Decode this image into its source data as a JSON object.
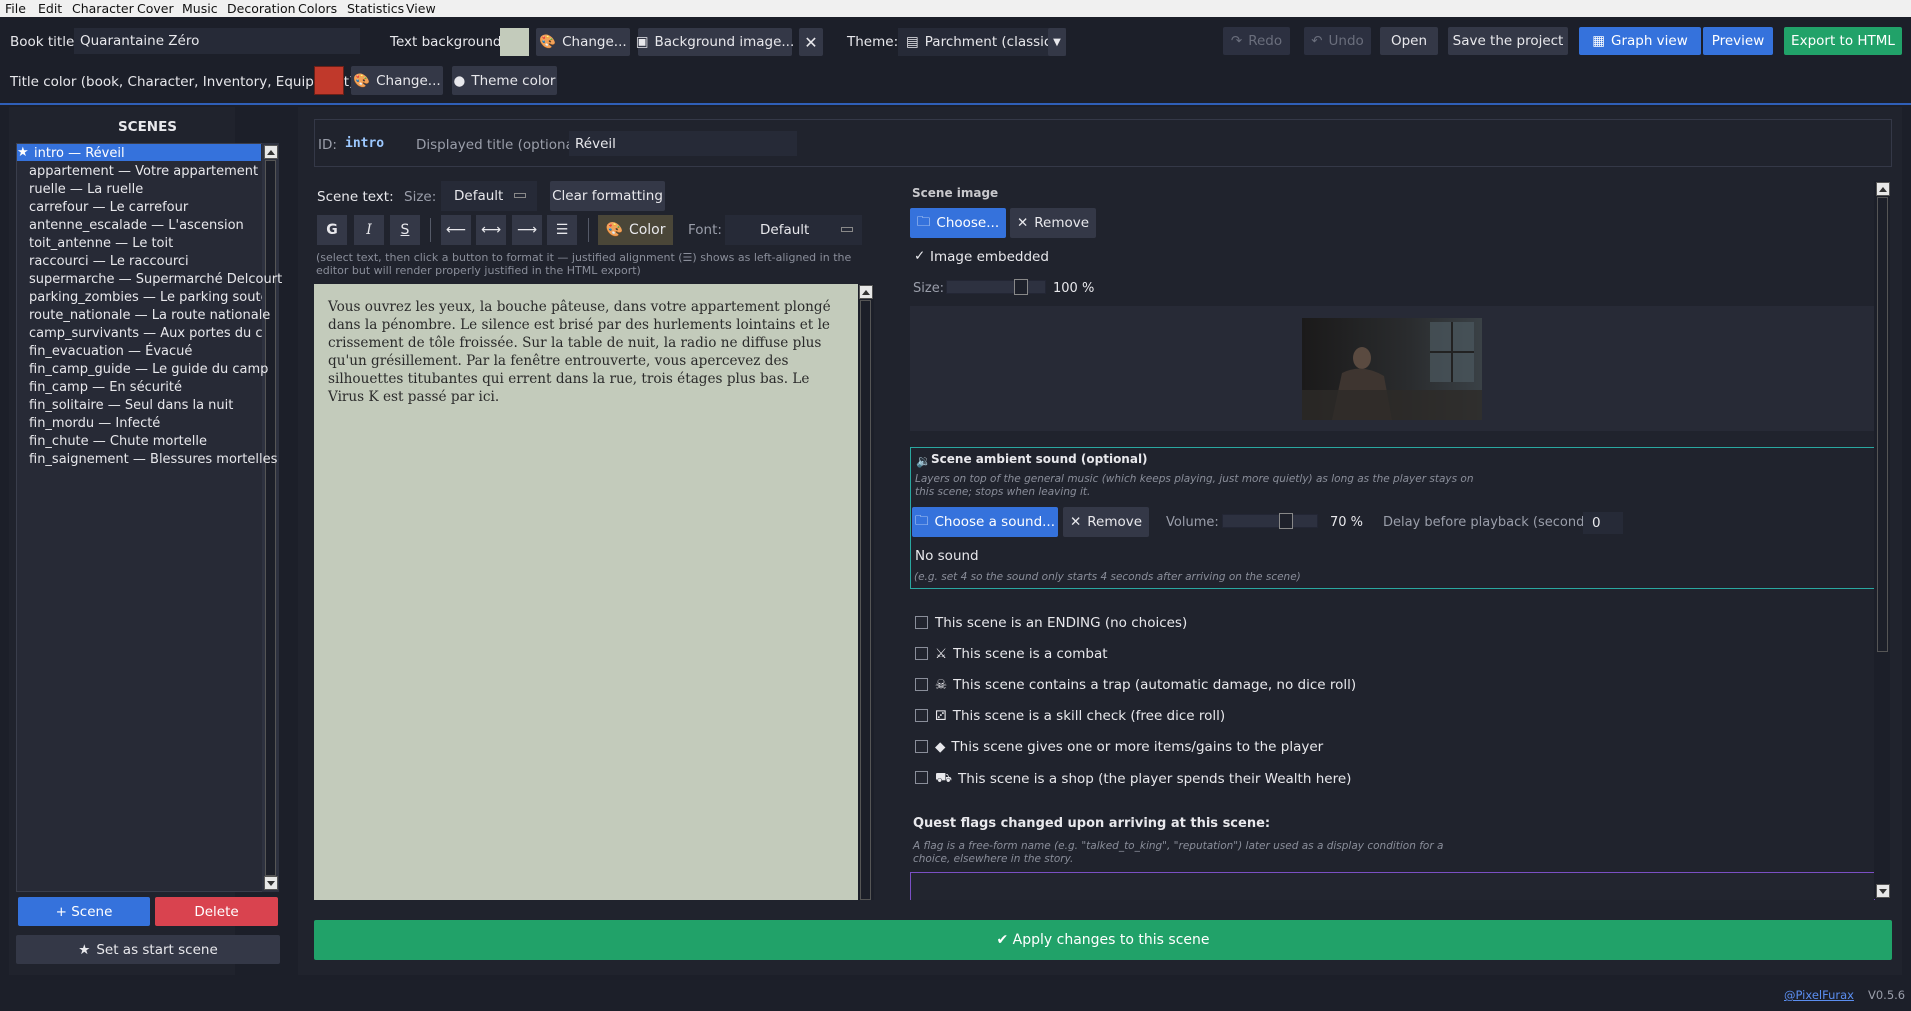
{
  "menu": [
    "File",
    "Edit",
    "Character",
    "Cover",
    "Music",
    "Decoration",
    "Colors",
    "Statistics",
    "View"
  ],
  "toolbar": {
    "book_title_label": "Book title:",
    "book_title_value": "Quarantaine Zéro",
    "text_bg_label": "Text background:",
    "text_bg_color": "#c3cbbb",
    "change_label": "Change...",
    "bg_image_label": "Background image...",
    "theme_label": "Theme:",
    "theme_value": "Parchment (classic)",
    "redo": "Redo",
    "undo": "Undo",
    "open": "Open",
    "save": "Save the project",
    "graph": "Graph view",
    "preview": "Preview",
    "export": "Export to HTML",
    "title_color_label": "Title color (book, Character, Inventory, Equipment):",
    "title_color": "#c0392b",
    "change2_label": "Change...",
    "theme_color_label": "Theme color"
  },
  "scenes": {
    "heading": "SCENES",
    "items": [
      "intro — Réveil",
      "appartement — Votre appartement",
      "ruelle — La ruelle",
      "carrefour — Le carrefour",
      "antenne_escalade — L'ascension",
      "toit_antenne — Le toit",
      "raccourci — Le raccourci",
      "supermarche — Supermarché Delcourt",
      "parking_zombies — Le parking souterra",
      "route_nationale — La route nationale",
      "camp_survivants — Aux portes du camp",
      "fin_evacuation — Évacué",
      "fin_camp_guide — Le guide du camp",
      "fin_camp — En sécurité",
      "fin_solitaire — Seul dans la nuit",
      "fin_mordu — Infecté",
      "fin_chute — Chute mortelle",
      "fin_saignement — Blessures mortelles"
    ],
    "add": "+ Scene",
    "delete": "Delete",
    "set_start": "Set as start scene"
  },
  "editor": {
    "id_label": "ID:",
    "id_value": "intro",
    "title_label": "Displayed title (optional):",
    "title_value": "Réveil",
    "scene_text_label": "Scene text:",
    "size_label": "Size:",
    "size_value": "Default",
    "clear_formatting": "Clear formatting",
    "bold": "G",
    "italic": "I",
    "strike": "S",
    "color": "Color",
    "font_label": "Font:",
    "font_value": "Default",
    "hint": "(select text, then click a button to format it — justified alignment (☰) shows as left-aligned in the editor but will render properly justified in the HTML export)",
    "text": "Vous ouvrez les yeux, la bouche pâteuse, dans votre appartement plongé dans la pénombre. Le silence est brisé par des hurlements lointains et le crissement de tôle froissée. Sur la table de nuit, la radio ne diffuse plus qu'un grésillement. Par la fenêtre entrouverte, vous apercevez des silhouettes titubantes qui errent dans la rue, trois étages plus bas. Le Virus K est passé par ici."
  },
  "image": {
    "heading": "Scene image",
    "choose": "Choose...",
    "remove": "Remove",
    "embedded": "Image embedded",
    "size_label": "Size:",
    "size_value": "100 %",
    "size_fraction": 0.8
  },
  "sound": {
    "heading": "Scene ambient sound (optional)",
    "desc": "Layers on top of the general music (which keeps playing, just more quietly) as long as the player stays on this scene; stops when leaving it.",
    "choose": "Choose a sound...",
    "remove": "Remove",
    "volume_label": "Volume:",
    "volume_value": "70 %",
    "volume_fraction": 0.7,
    "delay_label": "Delay before playback (seconds):",
    "delay_value": "0",
    "status": "No sound",
    "example": "(e.g. set 4 so the sound only starts 4 seconds after arriving on the scene)"
  },
  "options": [
    {
      "icon": "⚔",
      "label": "This scene is an ENDING (no choices)"
    },
    {
      "icon": "⚔",
      "label": "This scene is a combat"
    },
    {
      "icon": "☠",
      "label": "This scene contains a trap (automatic damage, no dice roll)"
    },
    {
      "icon": "⚂",
      "label": "This scene is a skill check (free dice roll)"
    },
    {
      "icon": "◆",
      "label": "This scene gives one or more items/gains to the player"
    },
    {
      "icon": "⛟",
      "label": "This scene is a shop (the player spends their Wealth here)"
    }
  ],
  "quest": {
    "heading": "Quest flags changed upon arriving at this scene:",
    "desc": "A flag is a free-form name (e.g. \"talked_to_king\", \"reputation\") later used as a display condition for a choice, elsewhere in the story."
  },
  "apply": "✔ Apply changes to this scene",
  "footer": {
    "author": "@PixelFurax",
    "version": "V0.5.6"
  },
  "colors": {
    "accent_blue": "#3572dc",
    "danger": "#d9434f",
    "success": "#21a269",
    "parchment": "#c3cbbb",
    "teal_border": "#2aa7a0",
    "purple_border": "#7a4fc4"
  }
}
